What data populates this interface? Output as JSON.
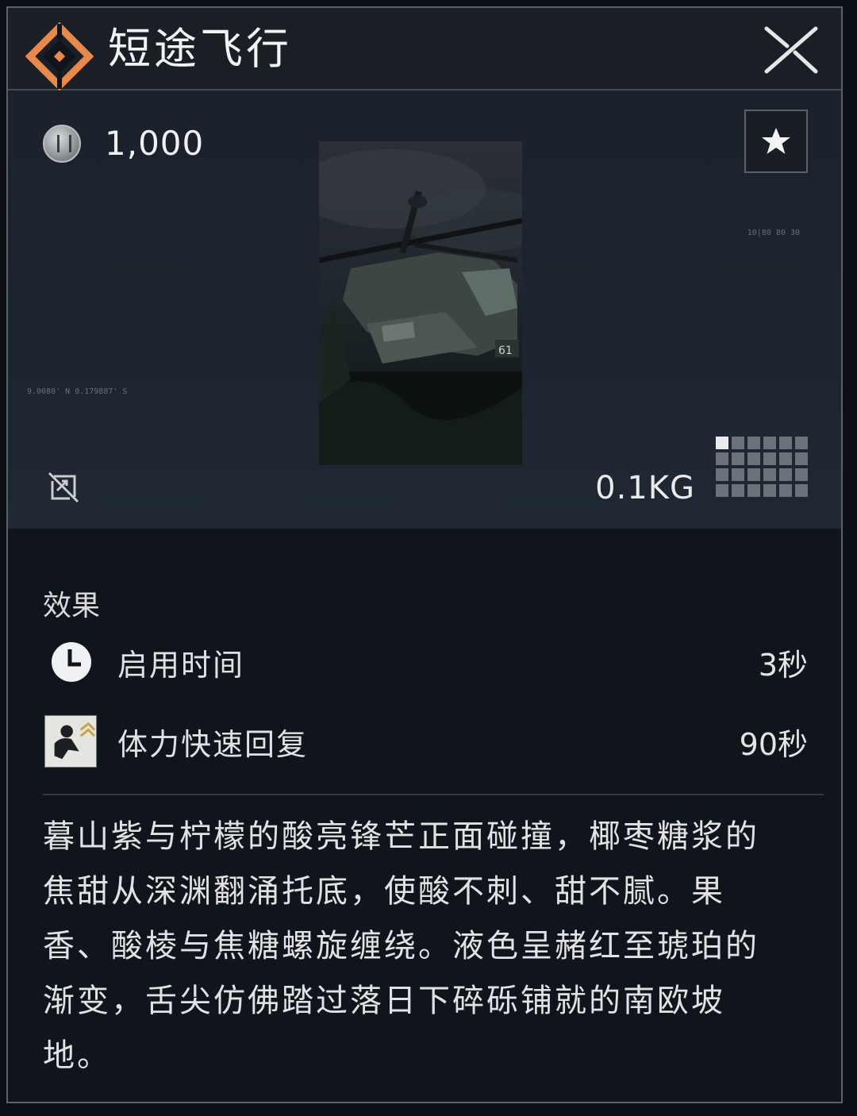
{
  "header": {
    "title": "短途飞行",
    "logo_icon": "orange-diamond-emblem-icon",
    "close_icon": "close-icon"
  },
  "item": {
    "price": "1,000",
    "currency_icon": "silver-coin-icon",
    "favorite_icon": "star-icon",
    "image_icon": "helicopter-wreck-icon",
    "hud_top": "10|80   80 30",
    "hud_left": "9.0080' N 0.179887' S",
    "untradeable_icon": "no-trade-icon",
    "weight": "0.1KG",
    "size_grid": {
      "columns": 6,
      "rows": 4,
      "occupied": 1
    }
  },
  "effects": {
    "label": "效果",
    "rows": [
      {
        "icon": "clock-icon",
        "label": "启用时间",
        "value": "3秒"
      },
      {
        "icon": "stamina-recovery-icon",
        "label": "体力快速回复",
        "value": "90秒"
      }
    ]
  },
  "description": "暮山紫与柠檬的酸亮锋芒正面碰撞，椰枣糖浆的焦甜从深渊翻涌托底，使酸不刺、甜不腻。果香、酸棱与焦糖螺旋缠绕。液色呈赭红至琥珀的渐变，舌尖仿佛踏过落日下碎砾铺就的南欧坡地。",
  "colors": {
    "accent": "#e07a3c",
    "panel": "#10151b",
    "header": "#1a1f26"
  }
}
